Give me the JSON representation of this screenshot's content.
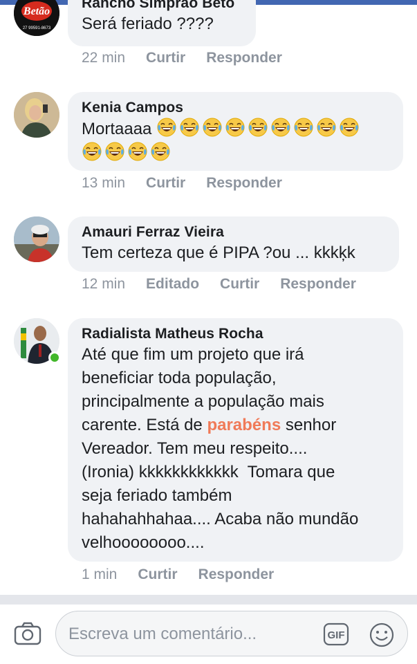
{
  "comments": [
    {
      "author": "Rancho Simprão Beto",
      "text": "Será feriado ????",
      "time": "22 min",
      "like": "Curtir",
      "reply": "Responder",
      "avatar_brand": "Betão",
      "avatar_phone": "27 99591-8673"
    },
    {
      "author": "Kenia Campos",
      "text": "Mortaaaa",
      "emoji": "😂",
      "time": "13 min",
      "like": "Curtir",
      "reply": "Responder"
    },
    {
      "author": "Amauri Ferraz Vieira",
      "text": "Tem certeza que é PIPA ?ou ... kkkķk",
      "time": "12 min",
      "edited": "Editado",
      "like": "Curtir",
      "reply": "Responder"
    },
    {
      "author": "Radialista Matheus Rocha",
      "text_lines": [
        "Até que fim um projeto que irá",
        "beneficiar toda população,",
        "principalmente a população mais",
        "carente. Está de",
        "Vereador. Tem meu respeito....",
        "(Ironia) kkkkkkkkkkkk  Tomara que",
        "seja feriado também",
        "hahahahhahaa.... Acaba não mundão",
        "velhoooooooo...."
      ],
      "highlight": "parabéns",
      "after_highlight": " senhor",
      "time": "1 min",
      "like": "Curtir",
      "reply": "Responder"
    }
  ],
  "composer": {
    "placeholder": "Escreva um comentário...",
    "gif_label": "GIF"
  },
  "colors": {
    "brand_bar": "#4267b2",
    "bubble": "#f0f2f5",
    "highlight": "#f07a58",
    "online": "#42b72a"
  },
  "icons": [
    "camera-icon",
    "gif-icon",
    "smiley-icon",
    "laughing-emoji"
  ]
}
